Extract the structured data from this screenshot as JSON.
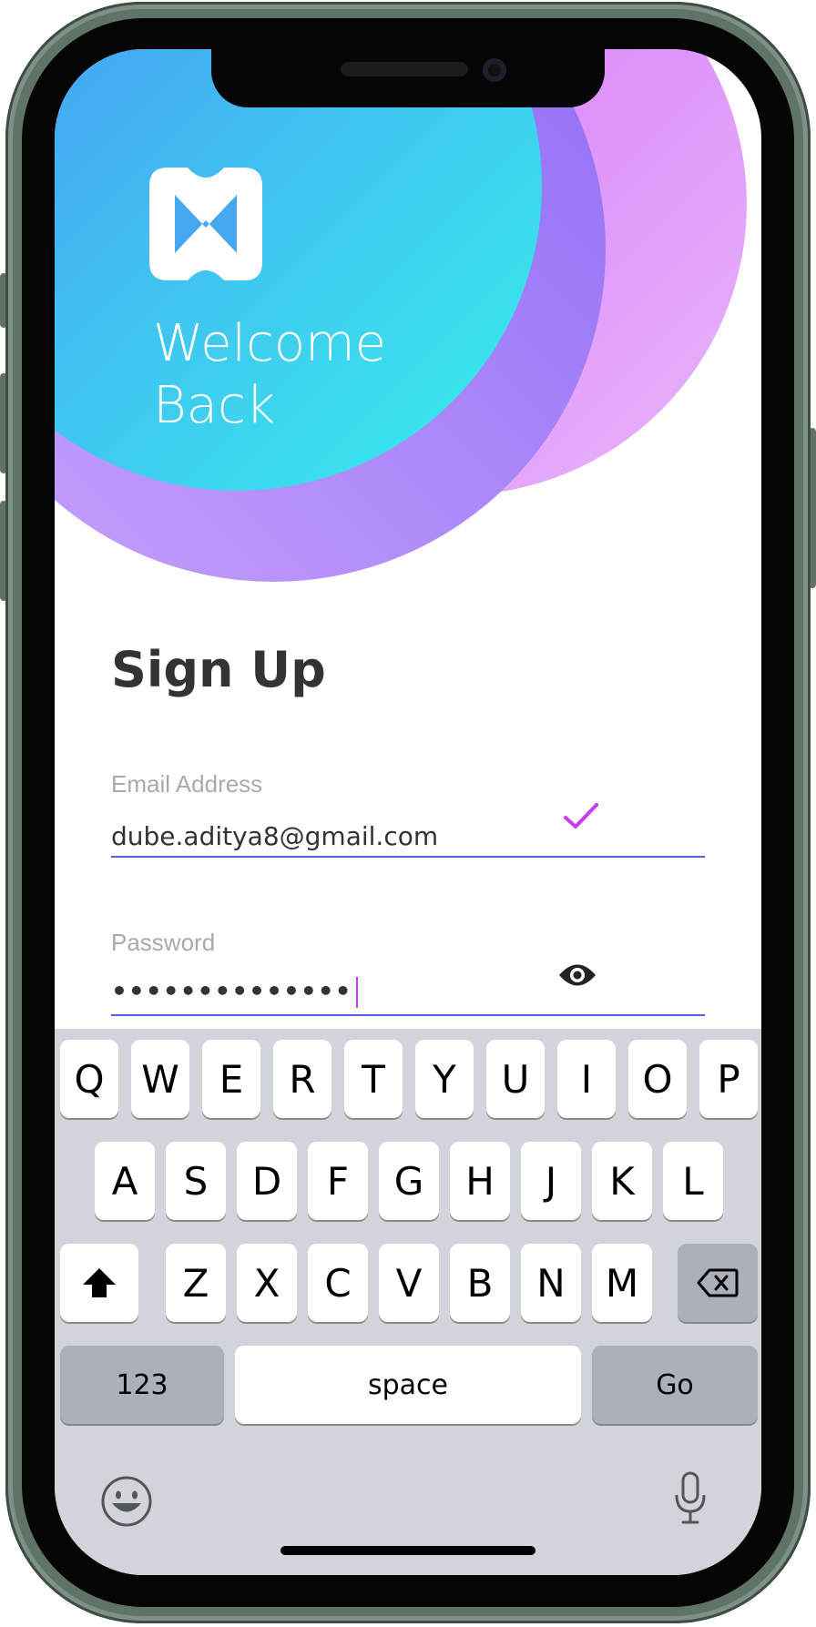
{
  "hero": {
    "welcome_line1": "Welcome",
    "welcome_line2": "Back"
  },
  "form": {
    "title": "Sign Up",
    "email_label": "Email Address",
    "email_value": "dube.aditya8@gmail.com",
    "password_label": "Password",
    "password_value": "••••••••••••••"
  },
  "keyboard": {
    "row1": [
      "Q",
      "W",
      "E",
      "R",
      "T",
      "Y",
      "U",
      "I",
      "O",
      "P"
    ],
    "row2": [
      "A",
      "S",
      "D",
      "F",
      "G",
      "H",
      "J",
      "K",
      "L"
    ],
    "row3": [
      "Z",
      "X",
      "C",
      "V",
      "B",
      "N",
      "M"
    ],
    "numbers_label": "123",
    "space_label": "space",
    "go_label": "Go"
  },
  "colors": {
    "accent": "#5863e0",
    "check": "#c93cf0",
    "gradient_start": "#4a8ff6",
    "gradient_end": "#37f1eb",
    "purple": "#9b6cf7"
  }
}
